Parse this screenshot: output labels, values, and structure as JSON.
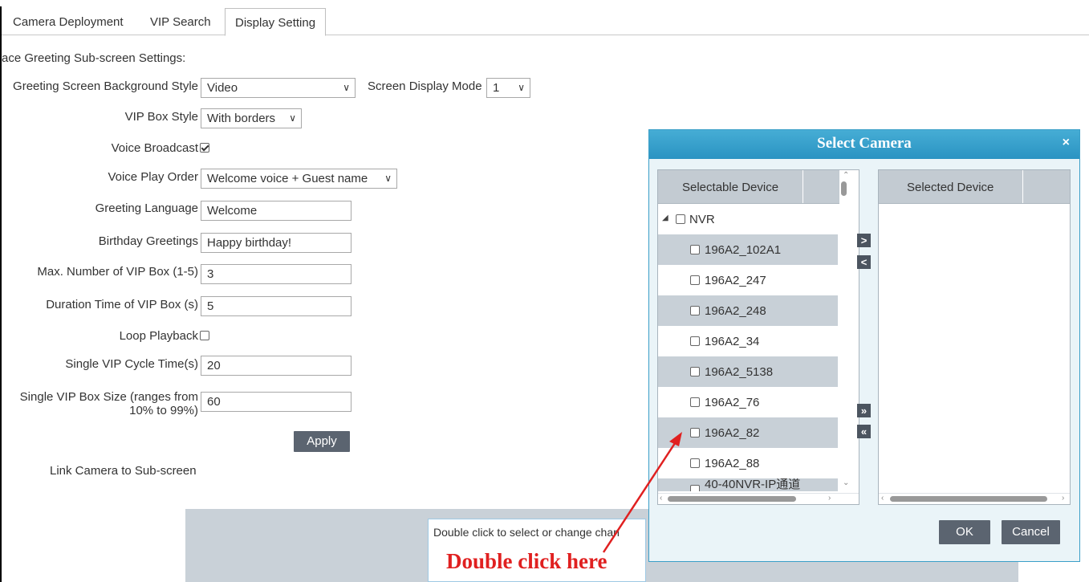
{
  "tabs": [
    {
      "label": "Camera Deployment"
    },
    {
      "label": "VIP Search"
    },
    {
      "label": "Display Setting",
      "active": true
    }
  ],
  "section_title": "ace Greeting Sub-screen Settings:",
  "form": {
    "bg_style_label": "Greeting Screen Background Style",
    "bg_style_value": "Video",
    "display_mode_label": "Screen Display Mode",
    "display_mode_value": "1",
    "vip_box_style_label": "VIP Box Style",
    "vip_box_style_value": "With borders",
    "voice_broadcast_label": "Voice Broadcast",
    "voice_broadcast_checked": true,
    "voice_play_order_label": "Voice Play Order",
    "voice_play_order_value": "Welcome voice + Guest name",
    "greeting_language_label": "Greeting Language",
    "greeting_language_value": "Welcome",
    "birthday_label": "Birthday Greetings",
    "birthday_value": "Happy birthday!",
    "max_vip_label": "Max. Number of VIP Box (1-5)",
    "max_vip_value": "3",
    "duration_label": "Duration Time of VIP Box (s)",
    "duration_value": "5",
    "loop_label": "Loop Playback",
    "loop_checked": false,
    "cycle_label": "Single VIP Cycle Time(s)",
    "cycle_value": "20",
    "box_size_label_1": "Single VIP Box Size (ranges from",
    "box_size_label_2": "10% to 99%)",
    "box_size_value": "60",
    "apply_label": "Apply",
    "link_camera_label": "Link Camera to Sub-screen"
  },
  "hint_text": "Double click to select or change chan",
  "annotation": "Double click here",
  "dialog": {
    "title": "Select Camera",
    "close_glyph": "×",
    "selectable_header": "Selectable Device",
    "selected_header": "Selected Device",
    "tree_root": "NVR",
    "devices": [
      "196A2_102A1",
      "196A2_247",
      "196A2_248",
      "196A2_34",
      "196A2_5138",
      "196A2_76",
      "196A2_82",
      "196A2_88",
      "40-40NVR-IP通道"
    ],
    "move_right": ">",
    "move_left": "<",
    "move_all_right": "»",
    "move_all_left": "«",
    "ok_label": "OK",
    "cancel_label": "Cancel"
  },
  "colors": {
    "dialog_header": "#2f9ac6",
    "button": "#5b6470",
    "annotation": "#e02020"
  }
}
